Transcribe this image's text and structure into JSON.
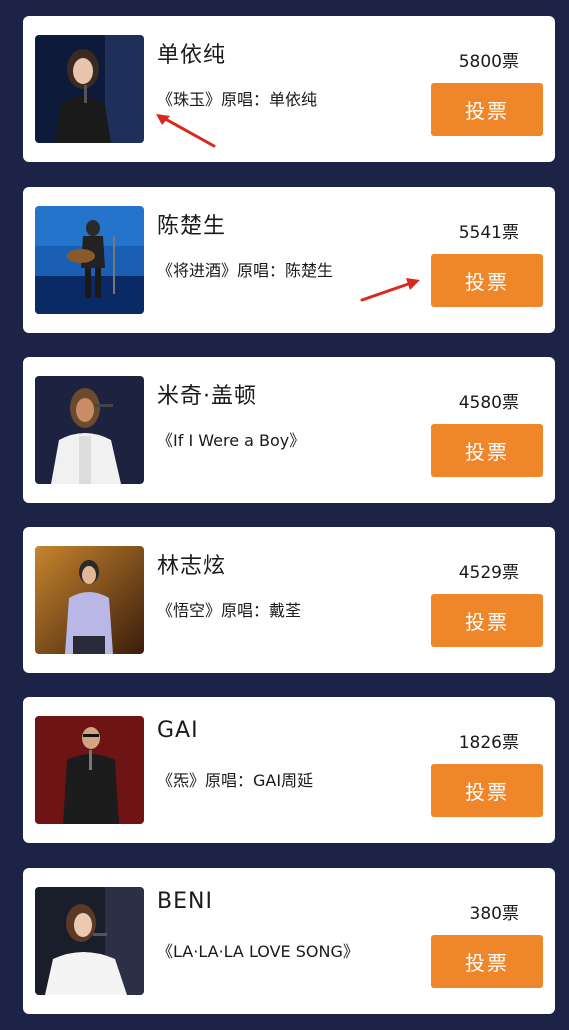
{
  "accent_color": "#f0862a",
  "background_color": "#1c2347",
  "candidates": [
    {
      "name": "单依纯",
      "song": "《珠玉》原唱：单依纯",
      "votes": "5800票",
      "button": "投票"
    },
    {
      "name": "陈楚生",
      "song": "《将进酒》原唱：陈楚生",
      "votes": "5541票",
      "button": "投票"
    },
    {
      "name": "米奇·盖顿",
      "song": "《If I Were a Boy》",
      "votes": "4580票",
      "button": "投票"
    },
    {
      "name": "林志炫",
      "song": "《悟空》原唱：戴荃",
      "votes": "4529票",
      "button": "投票"
    },
    {
      "name": "GAI",
      "song": "《炁》原唱：GAI周延",
      "votes": "1826票",
      "button": "投票"
    },
    {
      "name": "BENI",
      "song": "《LA·LA·LA LOVE SONG》",
      "votes": "380票",
      "button": "投票"
    }
  ],
  "annotations": [
    "red-arrow",
    "red-arrow"
  ],
  "watermark": ""
}
